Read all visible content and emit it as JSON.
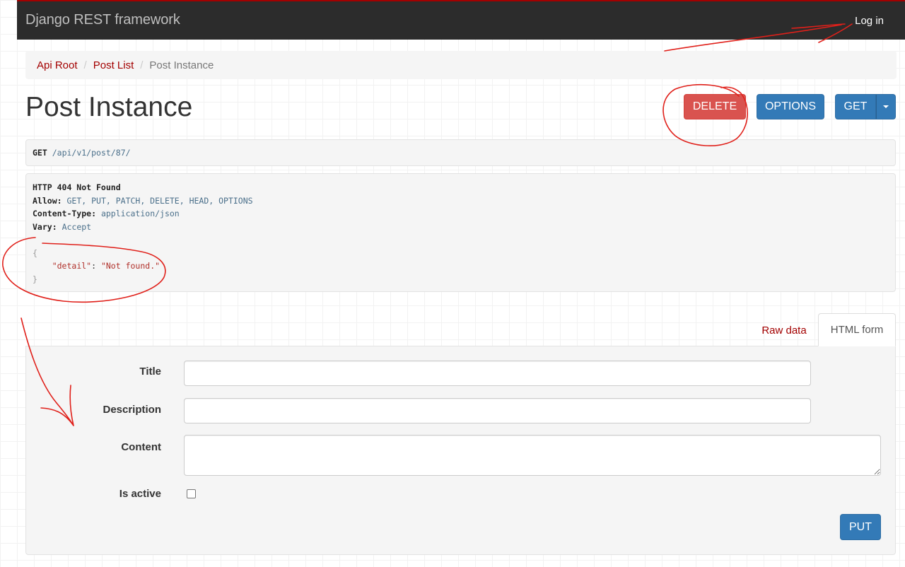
{
  "navbar": {
    "brand": "Django REST framework",
    "login_label": "Log in"
  },
  "breadcrumb": {
    "items": [
      {
        "label": "Api Root"
      },
      {
        "label": "Post List"
      },
      {
        "label": "Post Instance"
      }
    ],
    "separator": "/"
  },
  "header": {
    "title": "Post Instance",
    "buttons": {
      "delete": "DELETE",
      "options": "OPTIONS",
      "get": "GET"
    }
  },
  "request": {
    "method": "GET",
    "path_prefix": "/api/v1/post/",
    "path_id": "87",
    "path_suffix": "/"
  },
  "response": {
    "status": "HTTP 404 Not Found",
    "allow_key": "Allow:",
    "allow_value": "GET, PUT, PATCH, DELETE, HEAD, OPTIONS",
    "content_type_key": "Content-Type:",
    "content_type_value": "application/json",
    "vary_key": "Vary:",
    "vary_value": "Accept",
    "body_open": "{",
    "body_key": "\"detail\"",
    "body_colon": ": ",
    "body_value": "\"Not found.\"",
    "body_close": "}"
  },
  "tabs": {
    "raw": "Raw data",
    "html": "HTML form"
  },
  "form": {
    "fields": {
      "title": {
        "label": "Title",
        "value": ""
      },
      "description": {
        "label": "Description",
        "value": ""
      },
      "content": {
        "label": "Content",
        "value": ""
      },
      "is_active": {
        "label": "Is active",
        "checked": false
      }
    },
    "submit": "PUT"
  },
  "colors": {
    "navbar_bg": "#2c2c2c",
    "navbar_accent": "#a30000",
    "link": "#a30000",
    "danger": "#d9534f",
    "primary": "#337ab7",
    "annotation": "#e0201a"
  }
}
